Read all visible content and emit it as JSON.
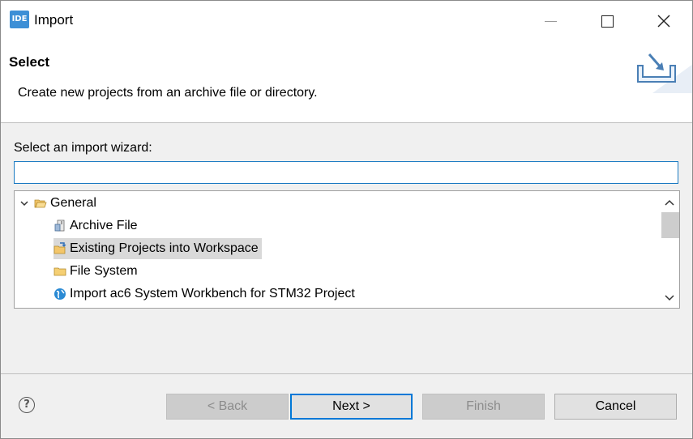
{
  "window": {
    "app_icon_label": "IDE",
    "title": "Import",
    "controls": [
      "minimize-icon",
      "maximize-icon",
      "close-icon"
    ]
  },
  "header": {
    "title": "Select",
    "description": "Create new projects from an archive file or directory.",
    "graphic_icon": "import-wizard-icon"
  },
  "body": {
    "wizard_label": "Select an import wizard:",
    "filter": {
      "value": "",
      "placeholder": ""
    },
    "tree": {
      "group": {
        "label": "General",
        "expanded": true,
        "icon": "open-folder-icon"
      },
      "items": [
        {
          "label": "Archive File",
          "icon": "archive-file-icon",
          "selected": false
        },
        {
          "label": "Existing Projects into Workspace",
          "icon": "existing-projects-icon",
          "selected": true
        },
        {
          "label": "File System",
          "icon": "folder-icon",
          "selected": false
        },
        {
          "label": "Import ac6 System Workbench for STM32 Project",
          "icon": "globe-icon",
          "selected": false
        }
      ]
    }
  },
  "footer": {
    "help_icon": "help-icon",
    "back_label": "< Back",
    "next_label": "Next >",
    "finish_label": "Finish",
    "cancel_label": "Cancel"
  },
  "colors": {
    "accent": "#0078d7",
    "filter_border": "#1b7ac2",
    "selection": "#d9d9d9",
    "dialog_bg": "#f0f0f0"
  }
}
